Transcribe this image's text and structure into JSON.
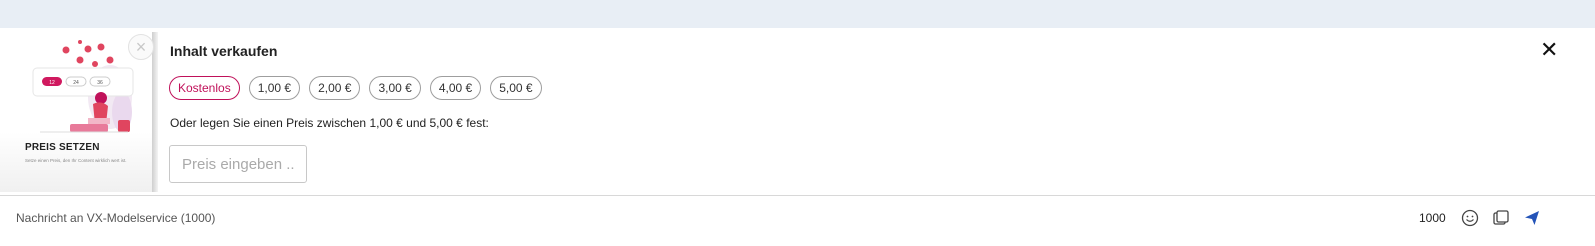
{
  "sell_panel": {
    "title": "Inhalt verkaufen",
    "close_icon": "close-icon",
    "price_options": [
      "Kostenlos",
      "1,00 €",
      "2,00 €",
      "3,00 €",
      "4,00 €",
      "5,00 €"
    ],
    "selected_option": "Kostenlos",
    "hint": "Oder legen Sie einen Preis zwischen 1,00 € und 5,00 € fest:",
    "price_input": {
      "value": "",
      "placeholder": "Preis eingeben .."
    }
  },
  "promo_card": {
    "title": "PREIS SETZEN",
    "description": "Setze einen Preis, den Ihr Content wirklich wert ist.",
    "illustration_values": [
      "12",
      "24",
      "36"
    ],
    "dismiss_icon": "circle-close-icon"
  },
  "composer": {
    "placeholder": "Nachricht an VX-Modelservice (1000)",
    "char_count": "1000",
    "emoji_icon": "emoji-icon",
    "gallery_icon": "gallery-icon",
    "send_icon": "send-icon"
  },
  "colors": {
    "accent": "#c0115a",
    "send": "#2454b8",
    "topbar": "#e8eef5"
  }
}
